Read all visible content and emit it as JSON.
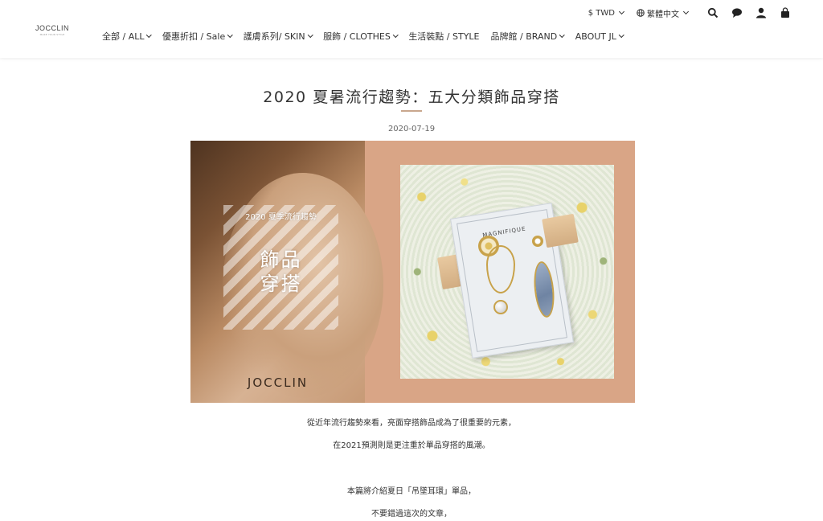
{
  "logo": {
    "brand": "JOCCLIN",
    "tagline": "MAKE YOUR STYLE"
  },
  "topbar": {
    "currency": "$ TWD",
    "language": "繁體中文",
    "icons": [
      "search-icon",
      "chat-icon",
      "user-icon",
      "cart-icon"
    ]
  },
  "nav": {
    "items": [
      {
        "label": "全部 / ALL"
      },
      {
        "label": "優惠折扣 / Sale"
      },
      {
        "label": "護膚系列/ SKIN"
      },
      {
        "label": "服飾 / CLOTHES"
      },
      {
        "label": "生活裝點 / STYLE"
      },
      {
        "label": "品牌館 / BRAND"
      },
      {
        "label": "ABOUT JL"
      }
    ]
  },
  "article": {
    "title": "2020 夏暑流行趨勢：五大分類飾品穿搭",
    "date": "2020-07-19",
    "banner": {
      "subtitle": "2020 夏季流行趨勢",
      "main_line1": "飾品",
      "main_line2": "穿搭",
      "logo": "JOCCLIN",
      "card_text": "MAGNIFIQUE"
    },
    "paragraphs": [
      "從近年流行趨勢來看，亮面穿搭飾品成為了很重要的元素，",
      "在2021預測則是更注重於單品穿搭的風潮。",
      "本篇將介紹夏日「吊墜耳環」單品，",
      "不要錯過這次的文章，"
    ]
  },
  "colors": {
    "accent": "#c9a78e",
    "banner_bg": "#d9a586"
  }
}
